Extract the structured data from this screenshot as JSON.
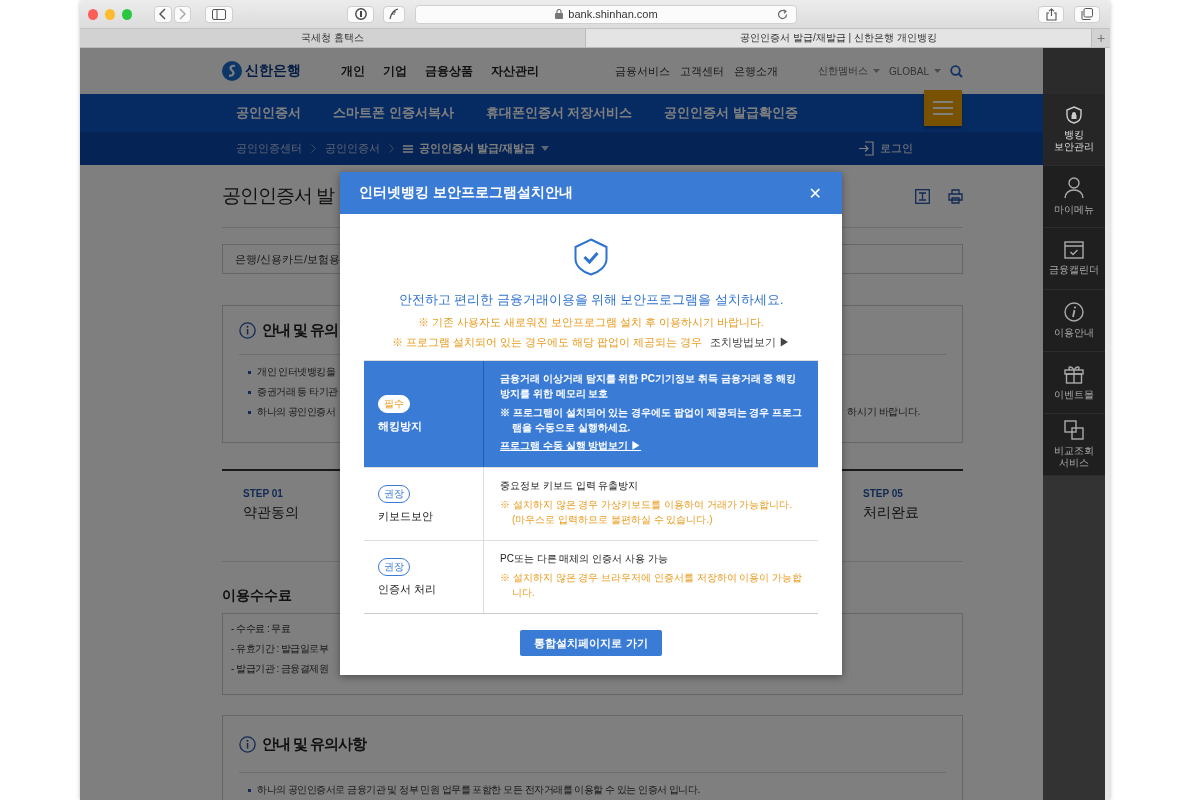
{
  "browser": {
    "url": "bank.shinhan.com",
    "tabs": [
      {
        "label": "국세청 홈택스",
        "selected": false
      },
      {
        "label": "공인인증서 발급/재발급 | 신한은행 개인뱅킹",
        "selected": true
      }
    ],
    "new_tab": "+"
  },
  "header": {
    "logo": "신한은행",
    "main_nav": [
      "개인",
      "기업",
      "금융상품",
      "자산관리"
    ],
    "utility_nav": [
      "금융서비스",
      "고객센터",
      "은행소개"
    ],
    "dropdowns": [
      "신한멤버스",
      "GLOBAL"
    ]
  },
  "section_nav": [
    "공인인증서",
    "스마트폰 인증서복사",
    "휴대폰인증서 저장서비스",
    "공인인증서 발급확인증"
  ],
  "breadcrumb": {
    "items": [
      "공인인증센터",
      "공인인증서"
    ],
    "current": "공인인증서 발급/재발급",
    "login": "로그인"
  },
  "page": {
    "title": "공인인증서 발",
    "select": "은행/신용카드/보험용",
    "info_box": {
      "heading": "안내 및 유의",
      "bullets": [
        {
          "text": "개인 인터넷뱅킹을"
        },
        {
          "text": "증권거래 등 타기관"
        },
        {
          "text": "하나의 공인인증서",
          "tail": "하시기 바랍니다."
        }
      ]
    },
    "steps": [
      {
        "step": "STEP 01",
        "label": "약관동의"
      },
      {
        "step": "STEP 05",
        "label": "처리완료"
      }
    ],
    "fee": {
      "heading": "이용수수료",
      "items": [
        "- 수수료 : 무료",
        "- 유효기간 : 발급일로부",
        "- 발급기관 : 금융결제원"
      ]
    },
    "info_box_2": {
      "heading": "안내 및 유의사항",
      "bullets": [
        {
          "text": "하나의 공인인증서로 금융기관 및 정부 민원 업무를 포함한 모든 전자거래를 이용할 수 있는 인증서 입니다."
        }
      ]
    }
  },
  "sidebar": [
    {
      "label": "뱅킹 보안관리",
      "selected": true
    },
    {
      "label": "마이메뉴",
      "selected": false
    },
    {
      "label": "금융캘린더",
      "selected": false
    },
    {
      "label": "이용안내",
      "selected": false
    },
    {
      "label": "이벤트몰",
      "selected": false
    },
    {
      "label": "비교조회 서비스",
      "selected": false
    }
  ],
  "modal": {
    "title": "인터넷뱅킹 보안프로그램설치안내",
    "close": "✕",
    "lead": "안전하고 편리한 금융거래이용을 위해 보안프로그램을 설치하세요.",
    "notes": [
      {
        "text": "※ 기존 사용자도 새로워진 보안프로그램 설치 후 이용하시기 바랍니다."
      },
      {
        "text": "※ 프로그램 설치되어 있는 경우에도 해당 팝업이 제공되는 경우",
        "link": "조치방법보기 ▶"
      }
    ],
    "rows": [
      {
        "required": true,
        "badge": "필수",
        "name": "해킹방지",
        "description": "금융거래 이상거래 탐지를 위한 PC기기정보 취득 금융거래 중 해킹방지를 위한 메모리 보호",
        "note": "※ 프로그램이 설치되어 있는 경우에도 팝업이 제공되는 경우 프로그램을 수동으로 실행하세요.",
        "link": "프로그램 수동 실행 방법보기 ▶"
      },
      {
        "required": false,
        "badge": "권장",
        "name": "키보드보안",
        "description": "중요정보 키보드 입력 유출방지",
        "note": "※ 설치하지 않은 경우 가상키보드를 이용하여 거래가 가능합니다.(마우스로 입력하므로 불편하실 수 있습니다.)"
      },
      {
        "required": false,
        "badge": "권장",
        "name": "인증서 처리",
        "description": "PC또는 다른 매체의 인증서 사용 가능",
        "note": "※ 설치하지 않은 경우 브라우저에 인증서를 저장하여 이용이 가능합니다."
      }
    ],
    "button": "통합설치페이지로 가기"
  }
}
